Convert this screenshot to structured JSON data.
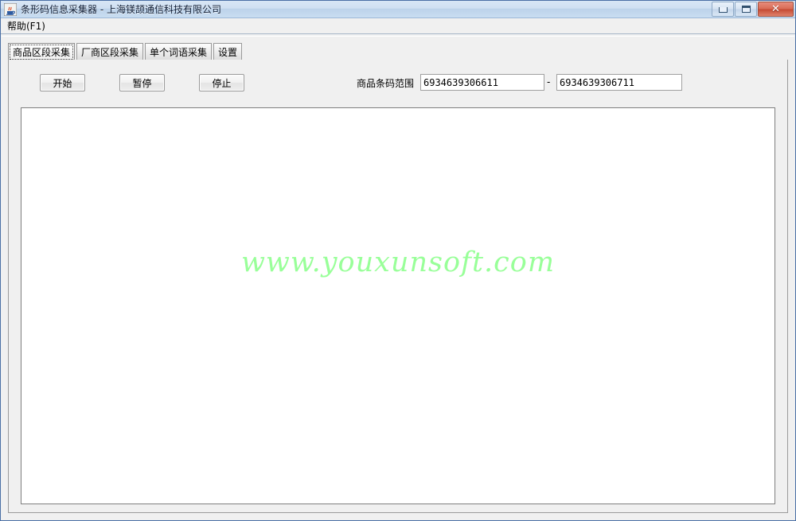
{
  "window": {
    "title": "条形码信息采集器 - 上海镁颉通信科技有限公司",
    "icon": "java-coffee-cup-icon",
    "controls": {
      "minimize_label": "",
      "maximize_label": "",
      "close_label": "✕"
    },
    "frame_color": "#4a6fa5",
    "titlebar_color": "#cfe0f2"
  },
  "menubar": {
    "items": [
      {
        "label": "帮助(F1)",
        "name": "menu-item-help"
      }
    ]
  },
  "tabs": [
    {
      "label": "商品区段采集",
      "name": "tab-product-segment",
      "selected": true
    },
    {
      "label": "厂商区段采集",
      "name": "tab-manufacturer-segment",
      "selected": false
    },
    {
      "label": "单个词语采集",
      "name": "tab-single-term",
      "selected": false
    },
    {
      "label": "设置",
      "name": "tab-settings",
      "selected": false
    }
  ],
  "toolbar": {
    "start_label": "开始",
    "pause_label": "暂停",
    "stop_label": "停止",
    "range_label": "商品条码范围",
    "range_separator": "-",
    "range_from_value": "6934639306611",
    "range_to_value": "6934639306711",
    "range_from_placeholder": "",
    "range_to_placeholder": ""
  },
  "output": {
    "watermark": "www.youxunsoft.com",
    "watermark_color": "#99ff99",
    "content": ""
  }
}
